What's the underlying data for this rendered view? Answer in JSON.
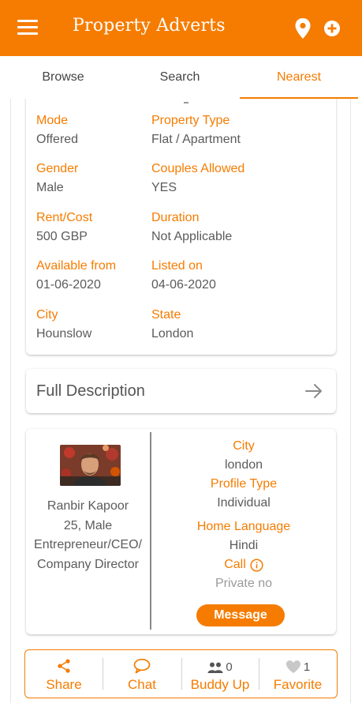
{
  "app": {
    "title": "Property Adverts",
    "brand_color": "#f57c00",
    "icons": [
      "menu-icon",
      "location-pin-icon",
      "add-circle-icon"
    ]
  },
  "tabs": [
    {
      "label": "Browse",
      "active": false
    },
    {
      "label": "Search",
      "active": false
    },
    {
      "label": "Nearest",
      "active": true
    }
  ],
  "details": {
    "mode": {
      "label": "Mode",
      "value": "Offered"
    },
    "property_type": {
      "label": "Property Type",
      "value": "Flat / Apartment"
    },
    "gender": {
      "label": "Gender",
      "value": "Male"
    },
    "couples_allowed": {
      "label": "Couples Allowed",
      "value": "YES"
    },
    "rent": {
      "label": "Rent/Cost",
      "value": "500 GBP"
    },
    "duration": {
      "label": "Duration",
      "value": "Not Applicable"
    },
    "available_from": {
      "label": "Available from",
      "value": "01-06-2020"
    },
    "listed_on": {
      "label": "Listed on",
      "value": "04-06-2020"
    },
    "city": {
      "label": "City",
      "value": "Hounslow"
    },
    "state": {
      "label": "State",
      "value": "London"
    }
  },
  "description": {
    "title": "Full Description",
    "icon": "arrow-right-icon"
  },
  "profile": {
    "name": "Ranbir Kapoor",
    "age_gender": "25, Male",
    "occupation_line1": "Entrepreneur/CEO/",
    "occupation_line2": "Company Director",
    "city_label": "City",
    "city_value": "london",
    "profile_type_label": "Profile Type",
    "profile_type_value": "Individual",
    "home_language_label": "Home Language",
    "home_language_value": "Hindi",
    "call_label": "Call",
    "call_icon": "info-icon",
    "phone_value": "Private no",
    "message_button": "Message"
  },
  "actions": {
    "share": {
      "label": "Share",
      "icon": "share-icon"
    },
    "chat": {
      "label": "Chat",
      "icon": "chat-bubble-icon"
    },
    "buddy": {
      "label": "Buddy Up",
      "icon": "people-icon",
      "count": "0"
    },
    "favorite": {
      "label": "Favorite",
      "icon": "heart-icon",
      "count": "1"
    }
  }
}
